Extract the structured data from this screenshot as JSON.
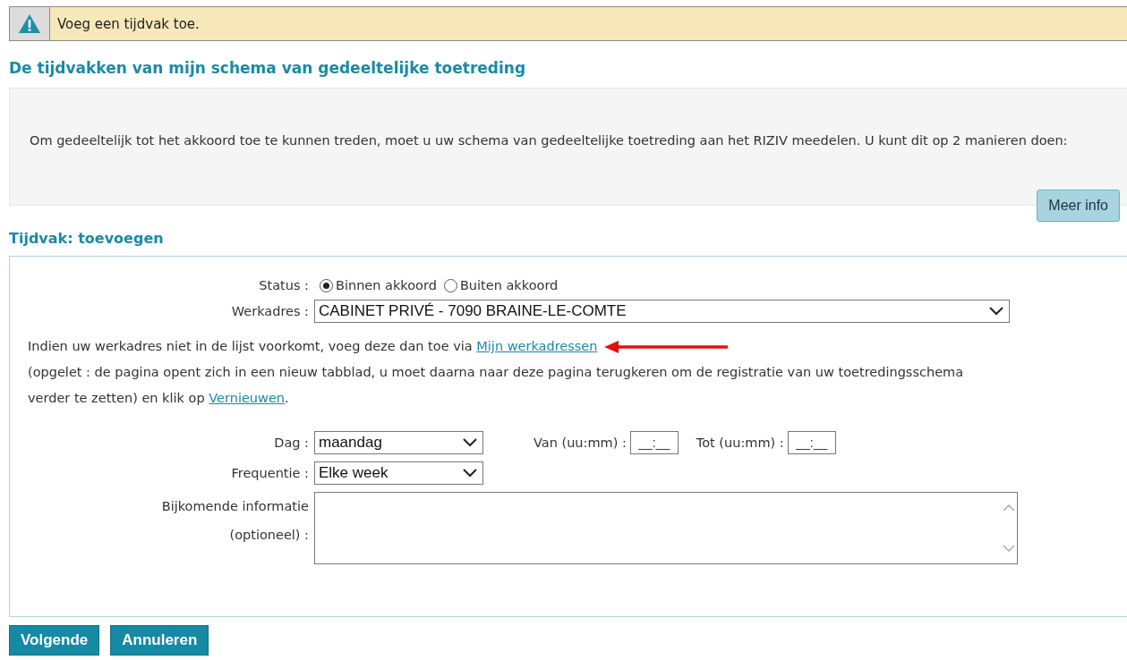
{
  "alert": {
    "message": "Voeg een tijdvak toe."
  },
  "page_title": "De tijdvakken van mijn schema van gedeeltelijke toetreding",
  "info_panel": {
    "text": "Om gedeeltelijk tot het akkoord toe te kunnen treden, moet u uw schema van gedeeltelijke toetreding aan het RIZIV meedelen. U kunt dit op 2 manieren doen:",
    "button": "Meer info"
  },
  "section_title": "Tijdvak: toevoegen",
  "form": {
    "status": {
      "label": "Status :",
      "options": [
        {
          "label": "Binnen akkoord",
          "selected": true
        },
        {
          "label": "Buiten akkoord",
          "selected": false
        }
      ]
    },
    "werkadres": {
      "label": "Werkadres :",
      "value": "CABINET PRIVÉ - 7090 BRAINE-LE-COMTE"
    },
    "notice": [
      [
        {
          "kind": "text",
          "text": "Indien uw werkadres niet in de lijst voorkomt, voeg deze dan toe via "
        },
        {
          "kind": "link",
          "text": "Mijn werkadressen"
        }
      ],
      [
        {
          "kind": "text",
          "text": "(opgelet : de pagina opent zich in een nieuw tabblad, u moet daarna naar deze pagina terugkeren om de registratie van uw toetredingsschema verder te zetten) en klik op "
        },
        {
          "kind": "link",
          "text": "Vernieuwen"
        },
        {
          "kind": "text",
          "text": "."
        }
      ]
    ],
    "dag": {
      "label": "Dag :",
      "value": "maandag"
    },
    "van": {
      "label": "Van (uu:mm) :",
      "placeholder": "__:__"
    },
    "tot": {
      "label": "Tot (uu:mm) :",
      "placeholder": "__:__"
    },
    "frequentie": {
      "label": "Frequentie :",
      "value": "Elke week"
    },
    "bijkomende": {
      "label_lines": [
        "Bijkomende informatie",
        "(optioneel) :"
      ]
    }
  },
  "buttons": [
    "Volgende",
    "Annuleren"
  ]
}
